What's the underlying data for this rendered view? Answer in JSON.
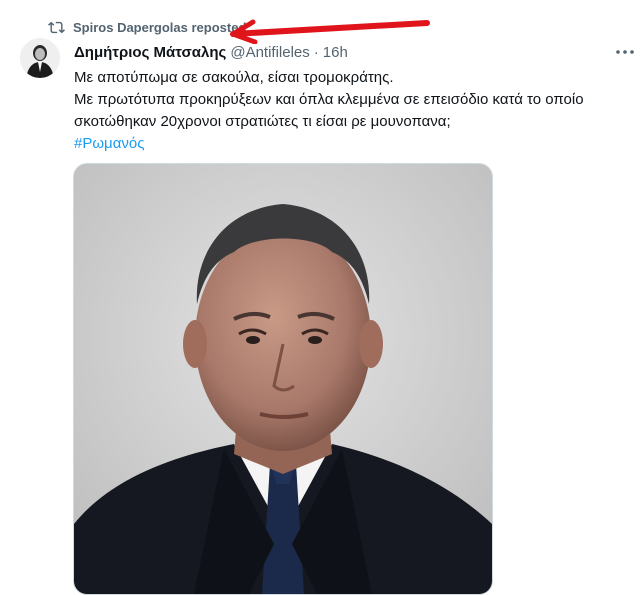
{
  "repost": {
    "label": "Spiros Dapergolas reposted"
  },
  "tweet": {
    "author_name": "Δημήτριος Μάτσαλης",
    "handle": "@Antifileles",
    "separator": "·",
    "time": "16h",
    "lines": [
      "Με αποτύπωμα σε σακούλα, είσαι τρομοκράτης.",
      "Με πρωτότυπα προκηρύξεων και όπλα κλεμμένα σε επεισόδιο κατά το οποίο σκοτώθηκαν 20χρονοι στρατιώτες τι είσαι ρε μουνοπανα;"
    ],
    "hashtag": "#Ρωμανός"
  },
  "colors": {
    "secondary_text": "#536471",
    "link": "#1d9bf0",
    "annotation_arrow": "#e0151b"
  },
  "icons": {
    "repost": "repost-icon",
    "more": "more-dots-icon"
  }
}
